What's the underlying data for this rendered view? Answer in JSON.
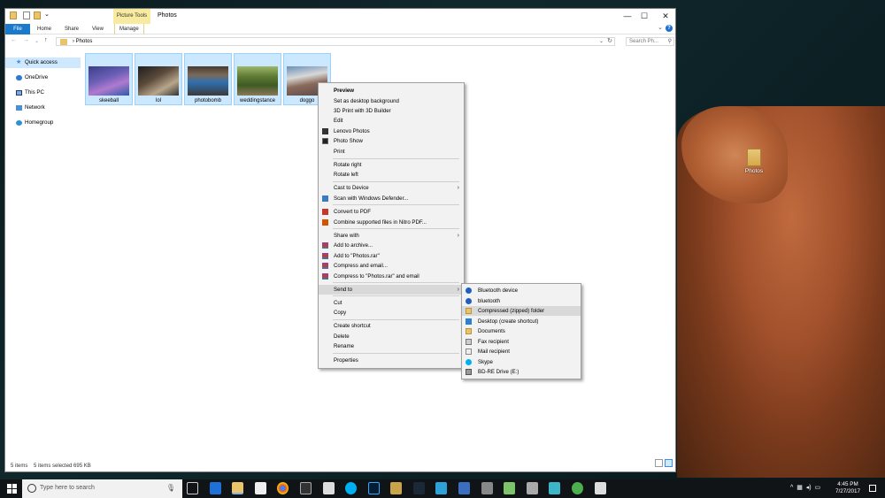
{
  "window": {
    "title": "Photos",
    "context_tab": "Picture Tools",
    "controls": {
      "minimize": "—",
      "maximize": "☐",
      "close": "✕"
    }
  },
  "ribbon": {
    "tabs": [
      "File",
      "Home",
      "Share",
      "View",
      "Manage"
    ],
    "expand": "⌄",
    "help": "?"
  },
  "address": {
    "crumb": "Photos",
    "search_placeholder": "Search Ph..."
  },
  "navpane": {
    "items": [
      {
        "label": "Quick access",
        "icon": "star-icon",
        "selected": true
      },
      {
        "label": "OneDrive",
        "icon": "cloud-icon"
      },
      {
        "label": "This PC",
        "icon": "computer-icon"
      },
      {
        "label": "Network",
        "icon": "network-icon"
      },
      {
        "label": "Homegroup",
        "icon": "homegroup-icon"
      }
    ]
  },
  "files": [
    {
      "name": "skeeball"
    },
    {
      "name": "lol"
    },
    {
      "name": "photobomb"
    },
    {
      "name": "weddingstance"
    },
    {
      "name": "doggo"
    }
  ],
  "status": {
    "count": "5 items",
    "selected": "5 items selected  695 KB"
  },
  "context_menu": {
    "items": [
      {
        "label": "Preview",
        "bold": true
      },
      {
        "label": "Set as desktop background"
      },
      {
        "label": "3D Print with 3D Builder"
      },
      {
        "label": "Edit"
      },
      {
        "label": "Lenovo Photos",
        "icon": "lenovo-photos-icon"
      },
      {
        "label": "Photo Show",
        "icon": "photo-show-icon"
      },
      {
        "label": "Print"
      },
      {
        "label": "Rotate right"
      },
      {
        "label": "Rotate left"
      },
      {
        "label": "Cast to Device",
        "submenu": true
      },
      {
        "label": "Scan with Windows Defender...",
        "icon": "defender-icon"
      },
      {
        "label": "Convert to PDF",
        "icon": "pdf-icon"
      },
      {
        "label": "Combine supported files in Nitro PDF...",
        "icon": "nitro-icon"
      },
      {
        "label": "Share with",
        "submenu": true
      },
      {
        "label": "Add to archive...",
        "icon": "winrar-icon"
      },
      {
        "label": "Add to \"Photos.rar\"",
        "icon": "winrar-icon"
      },
      {
        "label": "Compress and email...",
        "icon": "winrar-icon"
      },
      {
        "label": "Compress to \"Photos.rar\" and email",
        "icon": "winrar-icon"
      },
      {
        "label": "Send to",
        "submenu": true,
        "highlighted": true
      },
      {
        "label": "Cut"
      },
      {
        "label": "Copy"
      },
      {
        "label": "Create shortcut"
      },
      {
        "label": "Delete"
      },
      {
        "label": "Rename"
      },
      {
        "label": "Properties"
      }
    ]
  },
  "send_to_menu": {
    "items": [
      {
        "label": "Bluetooth device",
        "icon": "bluetooth-icon"
      },
      {
        "label": "bluetooth",
        "icon": "bluetooth-icon"
      },
      {
        "label": "Compressed (zipped) folder",
        "icon": "zip-folder-icon",
        "highlighted": true
      },
      {
        "label": "Desktop (create shortcut)",
        "icon": "desktop-icon"
      },
      {
        "label": "Documents",
        "icon": "documents-icon"
      },
      {
        "label": "Fax recipient",
        "icon": "fax-icon"
      },
      {
        "label": "Mail recipient",
        "icon": "mail-icon"
      },
      {
        "label": "Skype",
        "icon": "skype-icon"
      },
      {
        "label": "BD-RE Drive (E:)",
        "icon": "drive-icon"
      }
    ]
  },
  "desktop": {
    "icon_label": "Photos"
  },
  "taskbar": {
    "search_placeholder": "Type here to search",
    "time": "4:45 PM",
    "date": "7/27/2017"
  }
}
